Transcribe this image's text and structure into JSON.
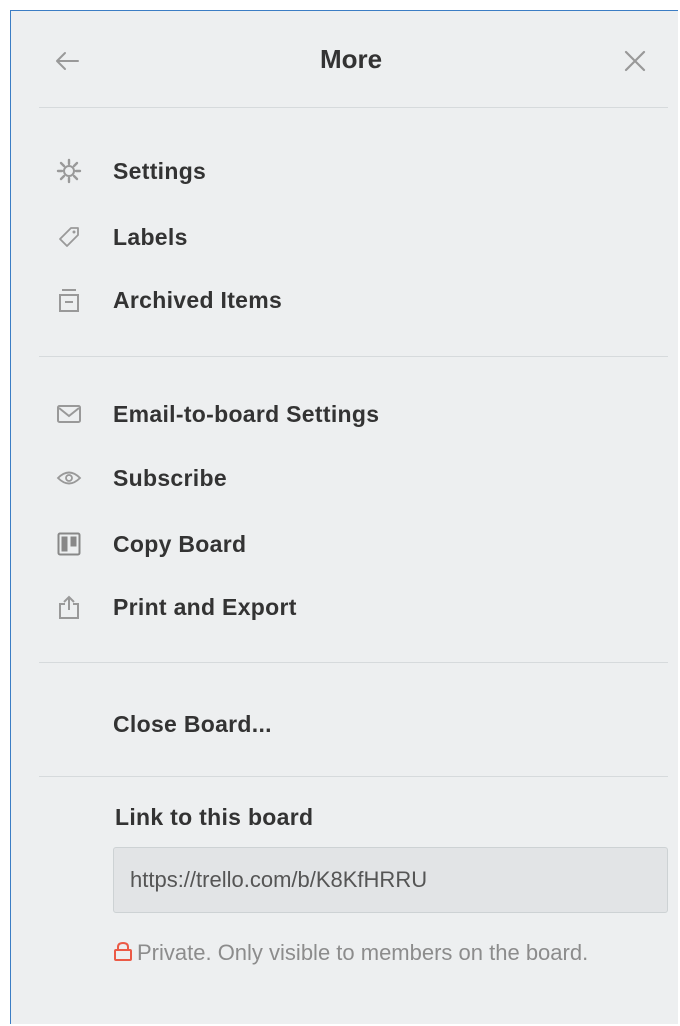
{
  "header": {
    "title": "More"
  },
  "menu": {
    "group1": [
      {
        "label": "Settings",
        "icon": "gear-icon"
      },
      {
        "label": "Labels",
        "icon": "tag-icon"
      },
      {
        "label": "Archived Items",
        "icon": "archive-icon"
      }
    ],
    "group2": [
      {
        "label": "Email-to-board Settings",
        "icon": "email-icon"
      },
      {
        "label": "Subscribe",
        "icon": "eye-icon"
      },
      {
        "label": "Copy Board",
        "icon": "board-icon"
      },
      {
        "label": "Print and Export",
        "icon": "share-icon"
      }
    ],
    "close_board": "Close Board..."
  },
  "link": {
    "heading": "Link to this board",
    "url": "https://trello.com/b/K8KfHRRU",
    "privacy_text": "Private. Only visible to members on the board."
  },
  "colors": {
    "panel_bg": "#edeff0",
    "text": "#333333",
    "muted": "#8c8c8c",
    "lock": "#eb5a46",
    "border": "#3b7dc4"
  }
}
